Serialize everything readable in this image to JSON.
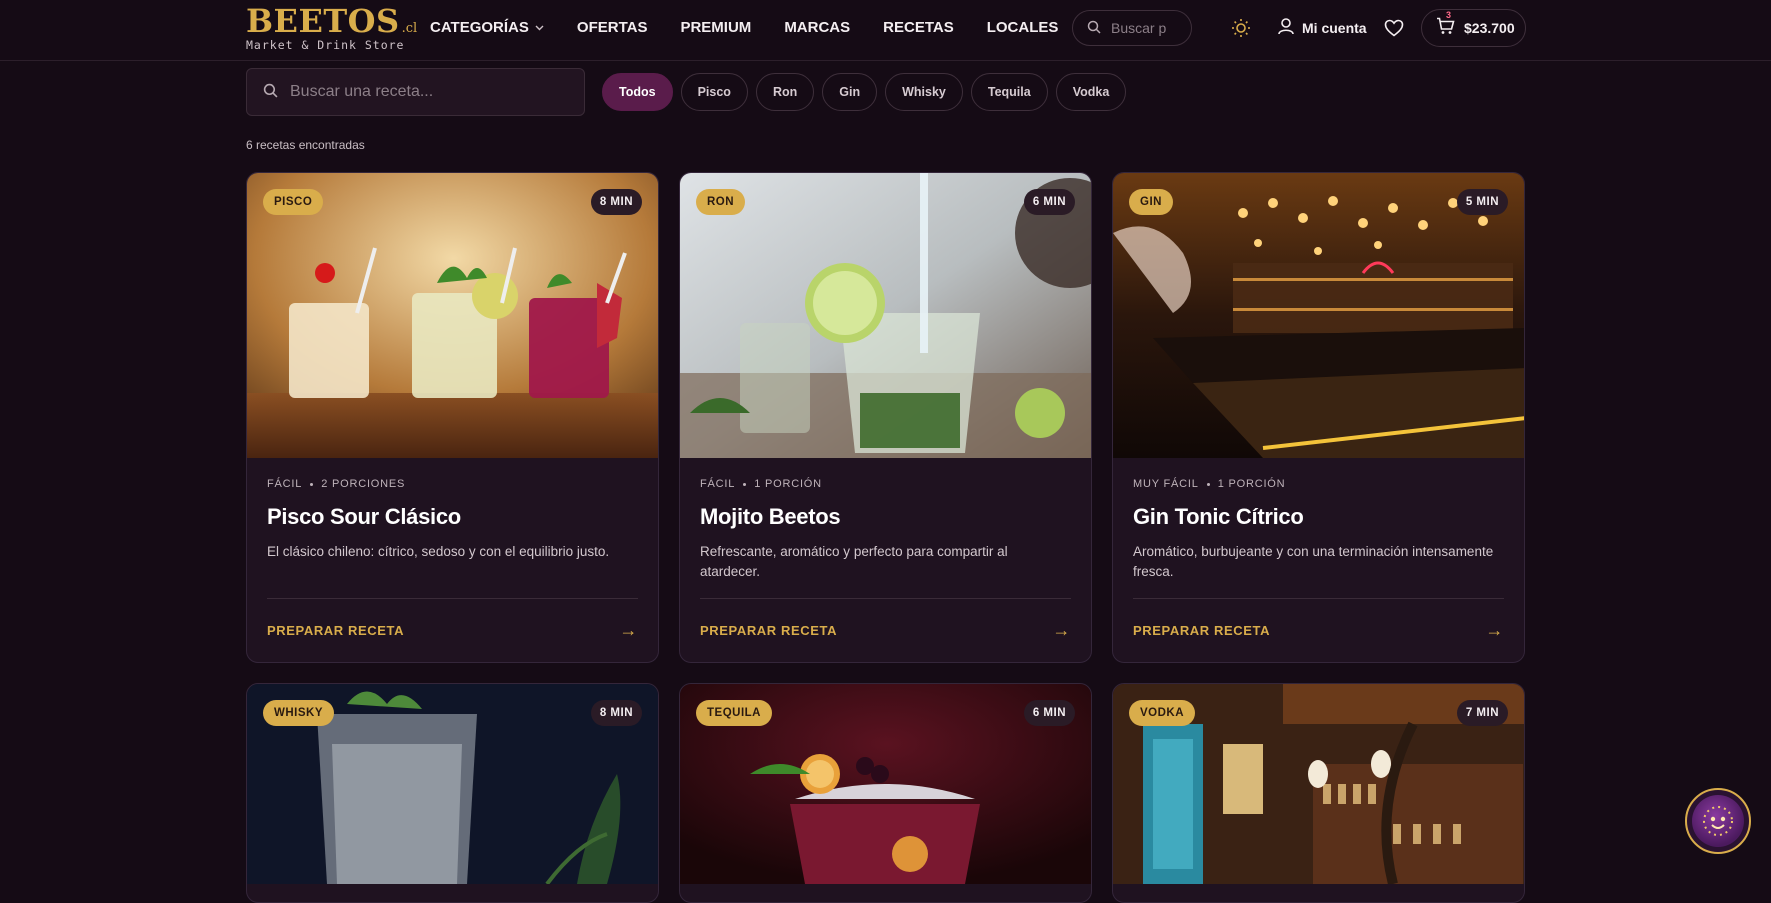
{
  "header": {
    "brand": "BEETOS",
    "tld": ".cl",
    "tagline": "Market & Drink Store",
    "nav": [
      "CATEGORÍAS",
      "OFERTAS",
      "PREMIUM",
      "MARCAS",
      "RECETAS",
      "LOCALES"
    ],
    "search_placeholder": "Buscar p",
    "account_label": "Mi cuenta",
    "cart_count": "3",
    "cart_total": "$23.700"
  },
  "filters": {
    "search_placeholder": "Buscar una receta...",
    "chips": [
      "Todos",
      "Pisco",
      "Ron",
      "Gin",
      "Whisky",
      "Tequila",
      "Vodka"
    ],
    "active_chip": "Todos",
    "result_count": "6 recetas encontradas"
  },
  "cards": [
    {
      "badge": "PISCO",
      "time": "8 MIN",
      "difficulty": "FÁCIL",
      "portions": "2 PORCIONES",
      "title": "Pisco Sour Clásico",
      "description": "El clásico chileno: cítrico, sedoso y con el equilibrio justo.",
      "cta": "PREPARAR RECETA"
    },
    {
      "badge": "RON",
      "time": "6 MIN",
      "difficulty": "FÁCIL",
      "portions": "1 PORCIÓN",
      "title": "Mojito Beetos",
      "description": "Refrescante, aromático y perfecto para compartir al atardecer.",
      "cta": "PREPARAR RECETA"
    },
    {
      "badge": "GIN",
      "time": "5 MIN",
      "difficulty": "MUY FÁCIL",
      "portions": "1 PORCIÓN",
      "title": "Gin Tonic Cítrico",
      "description": "Aromático, burbujeante y con una terminación intensamente fresca.",
      "cta": "PREPARAR RECETA"
    },
    {
      "badge": "WHISKY",
      "time": "8 MIN"
    },
    {
      "badge": "TEQUILA",
      "time": "6 MIN"
    },
    {
      "badge": "VODKA",
      "time": "7 MIN"
    }
  ],
  "colors": {
    "background": "#150b15",
    "accent_gold": "#d9ad4b",
    "active_chip": "#5a1c4b",
    "card": "#1f1220"
  },
  "icons": [
    "search-icon",
    "sun-icon",
    "user-icon",
    "heart-icon",
    "cart-icon",
    "chevron-down-icon",
    "arrow-right-icon",
    "assistant-icon"
  ]
}
